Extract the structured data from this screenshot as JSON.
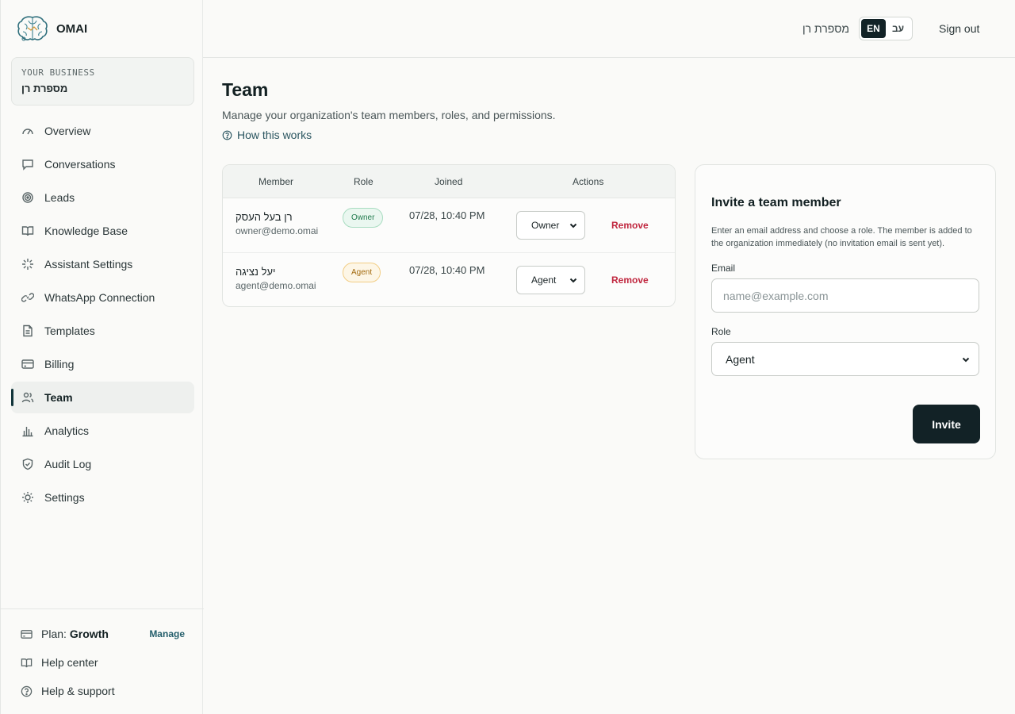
{
  "brand": {
    "name": "OMAI"
  },
  "business": {
    "label": "YOUR BUSINESS",
    "name": "מספרת רן"
  },
  "nav": {
    "items": [
      {
        "label": "Overview",
        "icon": "gauge-icon"
      },
      {
        "label": "Conversations",
        "icon": "chat-bubble-icon"
      },
      {
        "label": "Leads",
        "icon": "target-icon"
      },
      {
        "label": "Knowledge Base",
        "icon": "book-open-icon"
      },
      {
        "label": "Assistant Settings",
        "icon": "sparkle-icon"
      },
      {
        "label": "WhatsApp Connection",
        "icon": "link-icon"
      },
      {
        "label": "Templates",
        "icon": "file-text-icon"
      },
      {
        "label": "Billing",
        "icon": "credit-card-icon"
      },
      {
        "label": "Team",
        "icon": "users-icon",
        "active": true
      },
      {
        "label": "Analytics",
        "icon": "bar-chart-icon"
      },
      {
        "label": "Audit Log",
        "icon": "shield-check-icon"
      },
      {
        "label": "Settings",
        "icon": "sun-gear-icon"
      }
    ]
  },
  "footer": {
    "plan_label": "Plan:",
    "plan_name": "Growth",
    "manage_label": "Manage",
    "help_center": "Help center",
    "help_support": "Help & support"
  },
  "header": {
    "business_name": "מספרת רן",
    "lang_en": "EN",
    "lang_he": "עב",
    "sign_out": "Sign out"
  },
  "page": {
    "title": "Team",
    "subtitle": "Manage your organization's team members, roles, and permissions.",
    "how_link": "How this works"
  },
  "table": {
    "headers": {
      "member": "Member",
      "role": "Role",
      "joined": "Joined",
      "actions": "Actions"
    },
    "rows": [
      {
        "name": "רן בעל העסק",
        "email": "owner@demo.omai",
        "role_badge": "Owner",
        "joined": "07/28, 10:40 PM",
        "role_select": "Owner",
        "remove": "Remove"
      },
      {
        "name": "יעל נציגה",
        "email": "agent@demo.omai",
        "role_badge": "Agent",
        "joined": "07/28, 10:40 PM",
        "role_select": "Agent",
        "remove": "Remove"
      }
    ]
  },
  "invite": {
    "title": "Invite a team member",
    "description": "Enter an email address and choose a role. The member is added to the organization immediately (no invitation email is sent yet).",
    "email_label": "Email",
    "email_placeholder": "name@example.com",
    "role_label": "Role",
    "role_value": "Agent",
    "button": "Invite"
  }
}
